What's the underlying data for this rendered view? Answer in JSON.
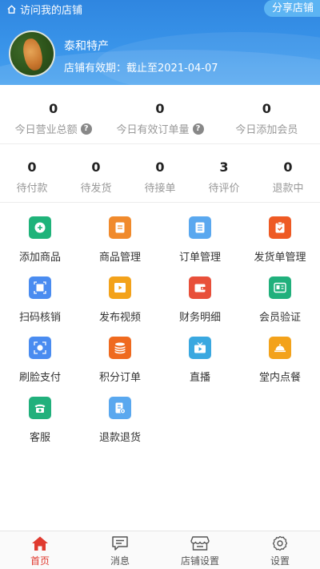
{
  "header": {
    "visit_label": "访问我的店铺",
    "share_label": "分享店铺",
    "shop_name": "泰和特产",
    "expiry_text": "店铺有效期：截止至2021-04-07"
  },
  "stats_today": [
    {
      "value": "0",
      "label": "今日营业总额",
      "help": true
    },
    {
      "value": "0",
      "label": "今日有效订单量",
      "help": true
    },
    {
      "value": "0",
      "label": "今日添加会员",
      "help": false
    }
  ],
  "order_status": [
    {
      "value": "0",
      "label": "待付款"
    },
    {
      "value": "0",
      "label": "待发货"
    },
    {
      "value": "0",
      "label": "待接单"
    },
    {
      "value": "3",
      "label": "待评价"
    },
    {
      "value": "0",
      "label": "退款中"
    }
  ],
  "functions": [
    {
      "label": "添加商品",
      "icon": "plus-circle-icon",
      "color": "#1fb37a"
    },
    {
      "label": "商品管理",
      "icon": "document-icon",
      "color": "#f08a2c"
    },
    {
      "label": "订单管理",
      "icon": "list-icon",
      "color": "#5aa8ef"
    },
    {
      "label": "发货单管理",
      "icon": "clipboard-check-icon",
      "color": "#ee5a24"
    },
    {
      "label": "扫码核销",
      "icon": "scan-icon",
      "color": "#4a8cf0"
    },
    {
      "label": "发布视频",
      "icon": "video-icon",
      "color": "#f3a21b"
    },
    {
      "label": "财务明细",
      "icon": "wallet-icon",
      "color": "#e8503a"
    },
    {
      "label": "会员验证",
      "icon": "member-card-icon",
      "color": "#21b07c"
    },
    {
      "label": "刷脸支付",
      "icon": "face-scan-icon",
      "color": "#4a8cf0"
    },
    {
      "label": "积分订单",
      "icon": "coin-stack-icon",
      "color": "#ef6a1f"
    },
    {
      "label": "直播",
      "icon": "tv-play-icon",
      "color": "#3aa8e0"
    },
    {
      "label": "堂内点餐",
      "icon": "dining-cloche-icon",
      "color": "#f3a21b"
    },
    {
      "label": "客服",
      "icon": "phone-icon",
      "color": "#21b07c"
    },
    {
      "label": "退款退货",
      "icon": "refund-icon",
      "color": "#5aa8ef"
    }
  ],
  "tabbar": [
    {
      "label": "首页",
      "icon": "home-icon",
      "active": true
    },
    {
      "label": "消息",
      "icon": "message-icon",
      "active": false
    },
    {
      "label": "店铺设置",
      "icon": "store-icon",
      "active": false
    },
    {
      "label": "设置",
      "icon": "gear-icon",
      "active": false
    }
  ],
  "colors": {
    "header_blue": "#3a95ea",
    "active_red": "#e03a2f"
  }
}
